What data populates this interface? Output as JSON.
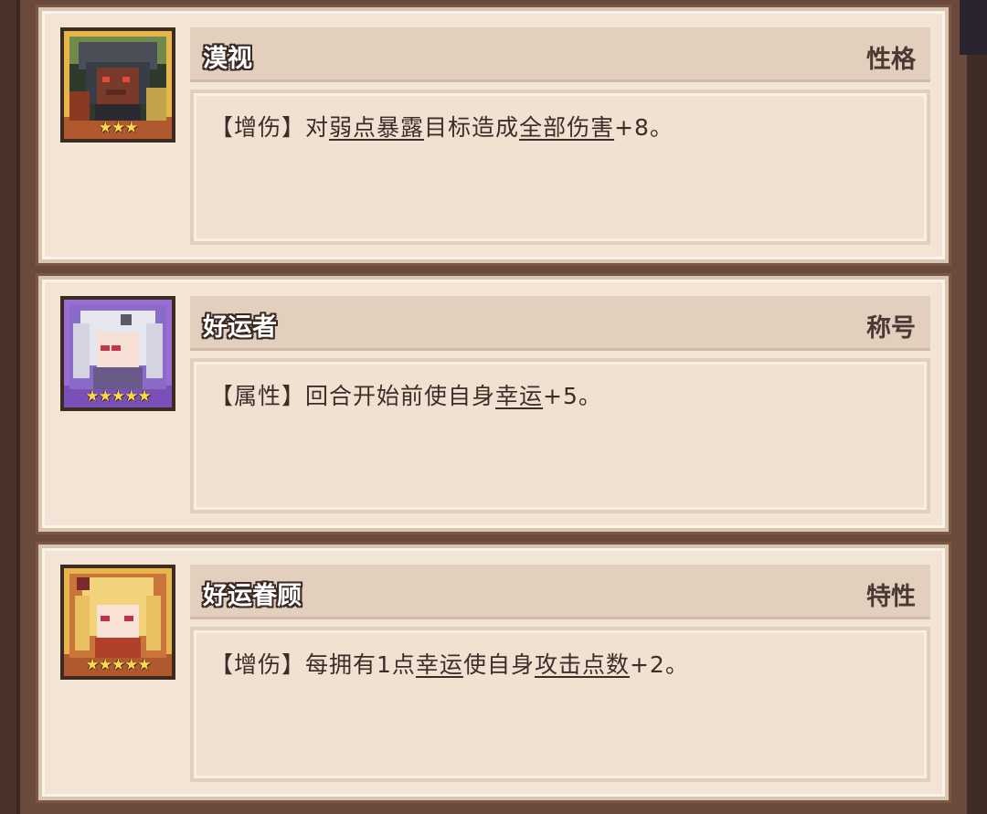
{
  "skills": [
    {
      "name": "漠视",
      "category": "性格",
      "stars": "★★★",
      "description": {
        "tag": "【增伤】",
        "part1": "对",
        "kw1": "弱点暴露",
        "part2": "目标造成",
        "kw2": "全部伤害",
        "part3": "+8。"
      }
    },
    {
      "name": "好运者",
      "category": "称号",
      "stars": "★★★★★",
      "description": {
        "tag": "【属性】",
        "part1": "回合开始前使自身",
        "kw1": "幸运",
        "part2": "+5。"
      }
    },
    {
      "name": "好运眷顾",
      "category": "特性",
      "stars": "★★★★★",
      "description": {
        "tag": "【增伤】",
        "part1": "每拥有1点",
        "kw1": "幸运",
        "part2": "使自身",
        "kw2": "攻击点数",
        "part3": "+2。"
      }
    }
  ],
  "colors": {
    "card_bg": "#f2e5d6",
    "header_bg": "#e2cfbd",
    "frame": "#6b4a3e",
    "text": "#3b2e2a"
  }
}
